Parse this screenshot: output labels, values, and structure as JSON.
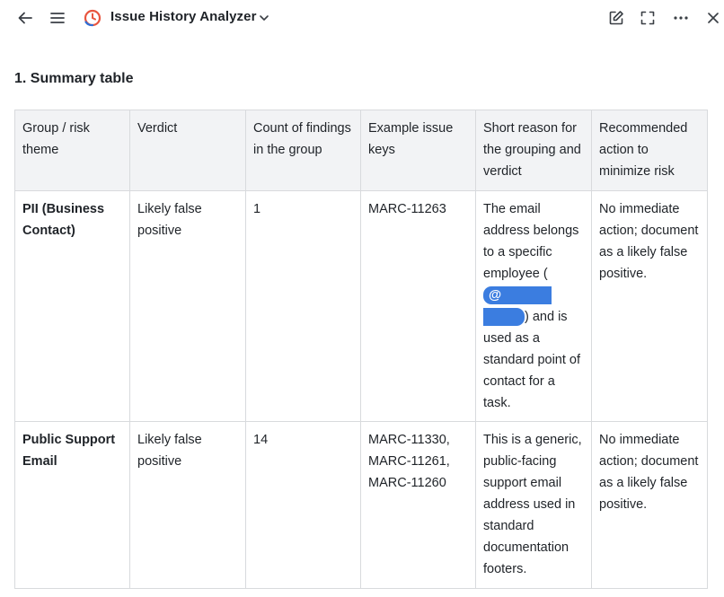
{
  "header": {
    "title": "Issue History Analyzer"
  },
  "section": {
    "heading": "1. Summary table"
  },
  "table": {
    "columns": [
      "Group / risk theme",
      "Verdict",
      "Count of findings in the group",
      "Example issue keys",
      "Short reason for the grouping and verdict",
      "Recommended action to minimize risk"
    ],
    "rows": [
      {
        "group": "PII (Business Contact)",
        "verdict": "Likely false positive",
        "count": "1",
        "keys": "MARC-11263",
        "reason_before": "The email address belongs to a specific employee (",
        "mention_symbol": "@",
        "reason_after": ") and is used as a standard point of contact for a task.",
        "action": "No immediate action; document as a likely false positive."
      },
      {
        "group": "Public Support Email",
        "verdict": "Likely false positive",
        "count": "14",
        "keys": "MARC-11330, MARC-11261, MARC-11260",
        "reason": "This is a generic, public-facing support email address used in standard documentation footers.",
        "action": "No immediate action; document as a likely false positive."
      }
    ]
  },
  "colors": {
    "mention": "#3b7de0",
    "header_bg": "#f2f3f5",
    "border": "#d8dadd"
  },
  "icons": [
    "back-arrow-icon",
    "menu-icon",
    "app-logo-icon",
    "chevron-down-icon",
    "edit-icon",
    "expand-icon",
    "more-icon",
    "close-icon"
  ]
}
